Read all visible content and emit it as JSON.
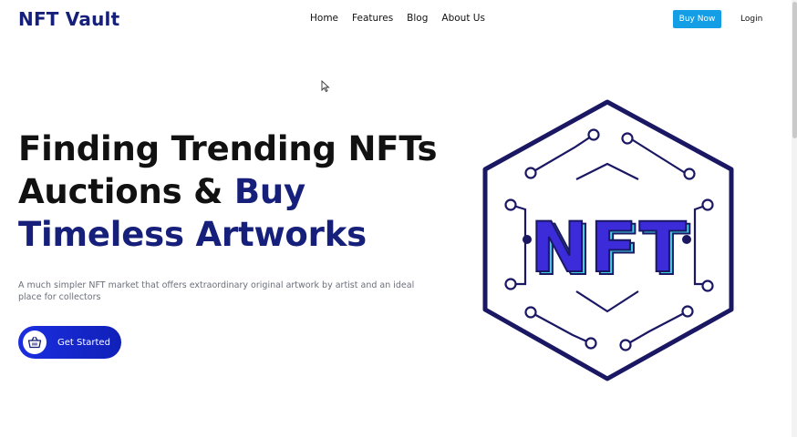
{
  "header": {
    "logo": "NFT Vault",
    "nav": [
      {
        "label": "Home"
      },
      {
        "label": "Features"
      },
      {
        "label": "Blog"
      },
      {
        "label": "About Us"
      }
    ],
    "buy_button": "Buy Now",
    "login": "Login"
  },
  "hero": {
    "title_part1": "Finding Trending NFTs Auctions & ",
    "title_highlight": "Buy Timeless Artworks",
    "subtitle": "A much simpler NFT market that offers extraordinary original artwork by artist and an ideal place for collectors",
    "cta_label": "Get Started"
  },
  "illustration": {
    "text": "NFT"
  },
  "colors": {
    "brand": "#16207a",
    "accent": "#139ee6",
    "cta": "#1b2ee0",
    "nft_text": "#3b2bd8",
    "nft_shadow": "#3fd0e6"
  }
}
